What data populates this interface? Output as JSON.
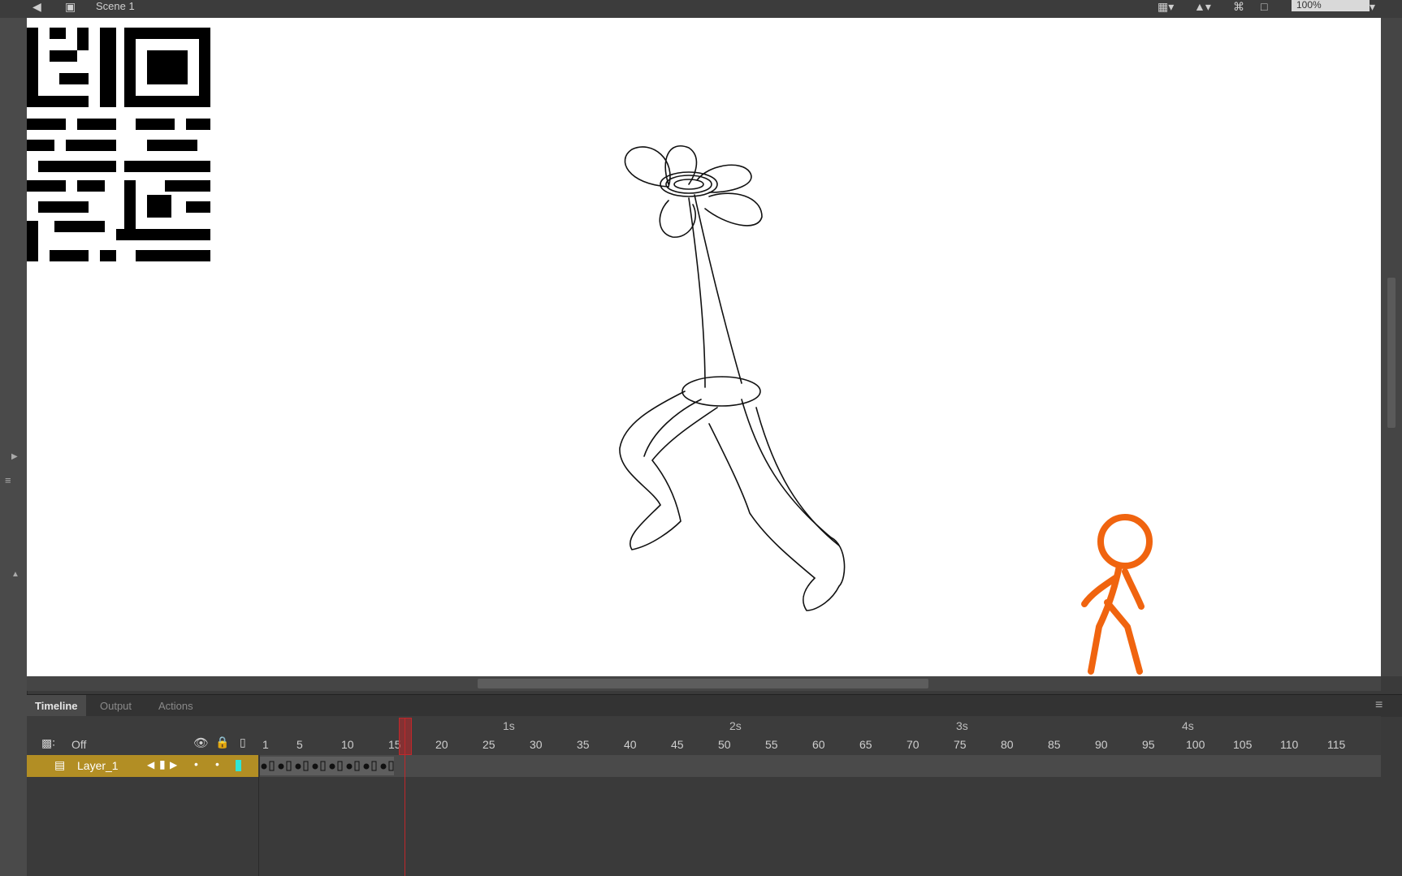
{
  "topbar": {
    "scene_label": "Scene 1",
    "zoom_value": "100%"
  },
  "stage": {
    "background": "#ffffff",
    "character_color": "#f0640f"
  },
  "panel_tabs": [
    {
      "label": "Timeline",
      "active": true
    },
    {
      "label": "Output",
      "active": false
    },
    {
      "label": "Actions",
      "active": false
    }
  ],
  "timeline": {
    "onion_label": "Off",
    "seconds": [
      "1s",
      "2s",
      "3s",
      "4s"
    ],
    "frame_numbers": [
      "1",
      "5",
      "10",
      "15",
      "20",
      "25",
      "30",
      "35",
      "40",
      "45",
      "50",
      "55",
      "60",
      "65",
      "70",
      "75",
      "80",
      "85",
      "90",
      "95",
      "100",
      "105",
      "110",
      "115"
    ],
    "layer": {
      "name": "Layer_1",
      "color": "#b28e24"
    },
    "current_frame": 16
  }
}
